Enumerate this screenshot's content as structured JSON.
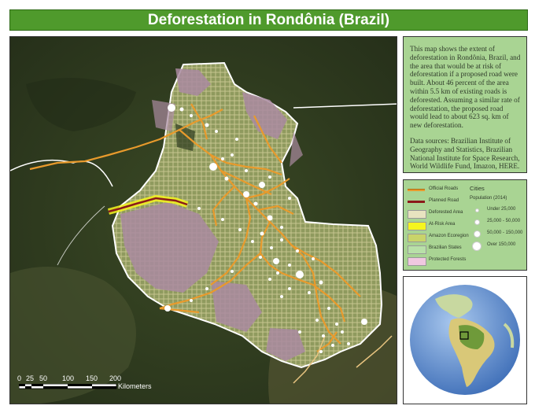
{
  "title": "Deforestation in Rondônia (Brazil)",
  "description": {
    "paragraph1": "This map shows the extent of deforestation in Rondônia, Brazil, and the area that would be at risk of deforestation if a proposed road were built. About 46 percent of the area within 5.5 km of existing roads is deforested. Assuming a similar rate of deforestation, the proposed road would lead to about 623 sq. km of new deforestation.",
    "paragraph2": "Data sources: Brazilian Institute of Geography and Statistics, Brazilian National Institute for Space Research, World Wildlife Fund, Imazon, HERE."
  },
  "legend": {
    "items": [
      {
        "label": "Official Roads",
        "color": "#e89a2c",
        "symbol": "line"
      },
      {
        "label": "Planned Road",
        "color": "#8b1a1a",
        "symbol": "line"
      },
      {
        "label": "Deforested Area",
        "color": "#e8e3c0",
        "symbol": "fill"
      },
      {
        "label": "At-Risk Area",
        "color": "#f5f51e",
        "symbol": "fill"
      },
      {
        "label": "Amazon Ecoregion",
        "color": "#c9d46a",
        "symbol": "fill"
      },
      {
        "label": "Brazilian States",
        "color": "#b8e0a8",
        "symbol": "fill"
      },
      {
        "label": "Protected Forests",
        "color": "#f0c8e0",
        "symbol": "fill"
      }
    ],
    "cities": {
      "heading": "Cities",
      "subheading": "Population (2014)",
      "classes": [
        "Under 25,000",
        "25,000 - 50,000",
        "50,000 - 150,000",
        "Over 150,000"
      ]
    }
  },
  "scale_bar": {
    "ticks": [
      "0",
      "25",
      "50",
      "100",
      "150",
      "200"
    ],
    "unit": "Kilometers"
  },
  "colors": {
    "title_bg": "#4f9a2c",
    "panel_bg": "#a9d493",
    "road": "#e89a2c",
    "planned_road": "#8b1a1a",
    "at_risk": "#f5f51e",
    "protected": "#a98aa0",
    "deforested": "#b9b98a"
  }
}
